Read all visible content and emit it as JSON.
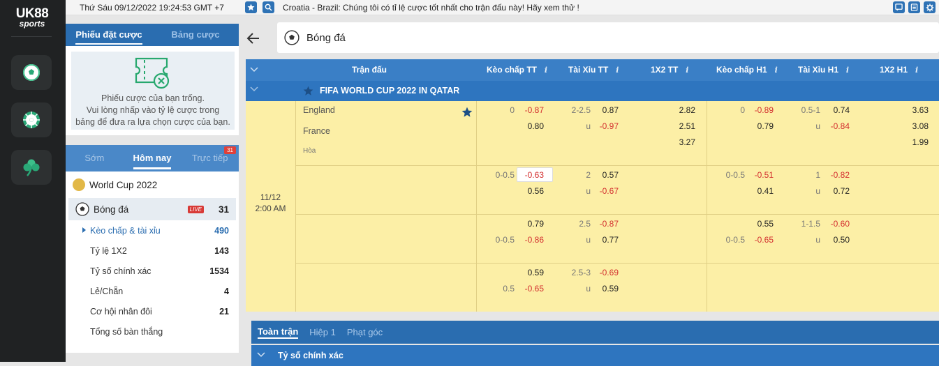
{
  "brand": {
    "line1": "UK88",
    "line2": "sports"
  },
  "sidebar_icons": [
    "soccer-ball-icon",
    "roulette-wheel-icon",
    "clover-icon"
  ],
  "topbar": {
    "datetime": "Thứ Sáu 09/12/2022 19:24:53 GMT +7",
    "marquee": "Croatia - Brazil: Chúng tôi có tỉ lệ cược tốt nhất cho trận đấu này! Hãy xem thử !"
  },
  "betslip": {
    "tabs": [
      "Phiếu đặt cược",
      "Bảng cược"
    ],
    "empty_line1": "Phiếu cược của bạn trống.",
    "empty_line2": "Vui lòng nhấp vào tỷ lệ cược trong",
    "empty_line3": "bảng để đưa ra lựa chọn cược của bạn."
  },
  "datetabs": {
    "early": "Sớm",
    "today": "Hôm nay",
    "live": "Trực tiếp",
    "live_count": "31"
  },
  "worldcup": "World Cup 2022",
  "sport": {
    "name": "Bóng đá",
    "live": "LIVE",
    "count": "31"
  },
  "markets": [
    {
      "label": "Kèo chấp & tài xỉu",
      "count": "490"
    },
    {
      "label": "Tỷ lệ 1X2",
      "count": "143"
    },
    {
      "label": "Tỷ số chính xác",
      "count": "1534"
    },
    {
      "label": "Lẻ/Chẵn",
      "count": "4"
    },
    {
      "label": "Cơ hội nhân đôi",
      "count": "21"
    },
    {
      "label": "Tổng số bàn thắng",
      "count": ""
    }
  ],
  "main": {
    "sport_title": "Bóng đá",
    "columns": {
      "match": "Trận đấu",
      "hdp_ft": "Kèo chấp TT",
      "ou_ft": "Tài Xỉu TT",
      "x12_ft": "1X2 TT",
      "hdp_h1": "Kèo chấp H1",
      "ou_h1": "Tài Xỉu H1",
      "x12_h1": "1X2 H1",
      "info": "i"
    },
    "league": "FIFA WORLD CUP 2022 IN QATAR",
    "match": {
      "home": "England",
      "away": "France",
      "draw": "Hòa",
      "date": "11/12",
      "time": "2:00 AM"
    },
    "odds": {
      "r1": {
        "hl": "0",
        "hh": "-0.87",
        "ha": "0.80",
        "ol": "2-2.5",
        "oo": "0.87",
        "ou": "u",
        "ouv": "-0.97",
        "x1": "2.82",
        "x2": "2.51",
        "xd": "3.27",
        "h1l": "0",
        "h1h": "-0.89",
        "h1a": "0.79",
        "o1l": "0.5-1",
        "o1o": "0.74",
        "o1u": "u",
        "o1uv": "-0.84",
        "y1": "3.63",
        "y2": "3.08",
        "yd": "1.99"
      },
      "r2": {
        "hl": "0-0.5",
        "hh": "-0.63",
        "ha": "0.56",
        "ol": "2",
        "oo": "0.57",
        "ou": "u",
        "ouv": "-0.67",
        "h1l": "0-0.5",
        "h1h": "-0.51",
        "h1a": "0.41",
        "o1l": "1",
        "o1o": "-0.82",
        "o1u": "u",
        "o1uv": "0.72"
      },
      "r3": {
        "hh": "0.79",
        "al": "0-0.5",
        "ha": "-0.86",
        "ol": "2.5",
        "oo": "-0.87",
        "ou": "u",
        "ouv": "0.77",
        "h1h": "0.55",
        "a1l": "0-0.5",
        "h1a": "-0.65",
        "o1l": "1-1.5",
        "o1o": "-0.60",
        "o1u": "u",
        "o1uv": "0.50"
      },
      "r4": {
        "hh": "0.59",
        "al": "0.5",
        "ha": "-0.65",
        "ol": "2.5-3",
        "oo": "-0.69",
        "ou": "u",
        "ouv": "0.59"
      }
    },
    "bottom_tabs": [
      "Toàn trận",
      "Hiệp 1",
      "Phạt góc"
    ],
    "section": "Tỷ số chính xác"
  },
  "colors": {
    "primary": "#2a6db0",
    "header": "#3a7fc6",
    "odds_bg": "#fcefa6",
    "negative": "#d32f2f",
    "live": "#d83a36"
  }
}
